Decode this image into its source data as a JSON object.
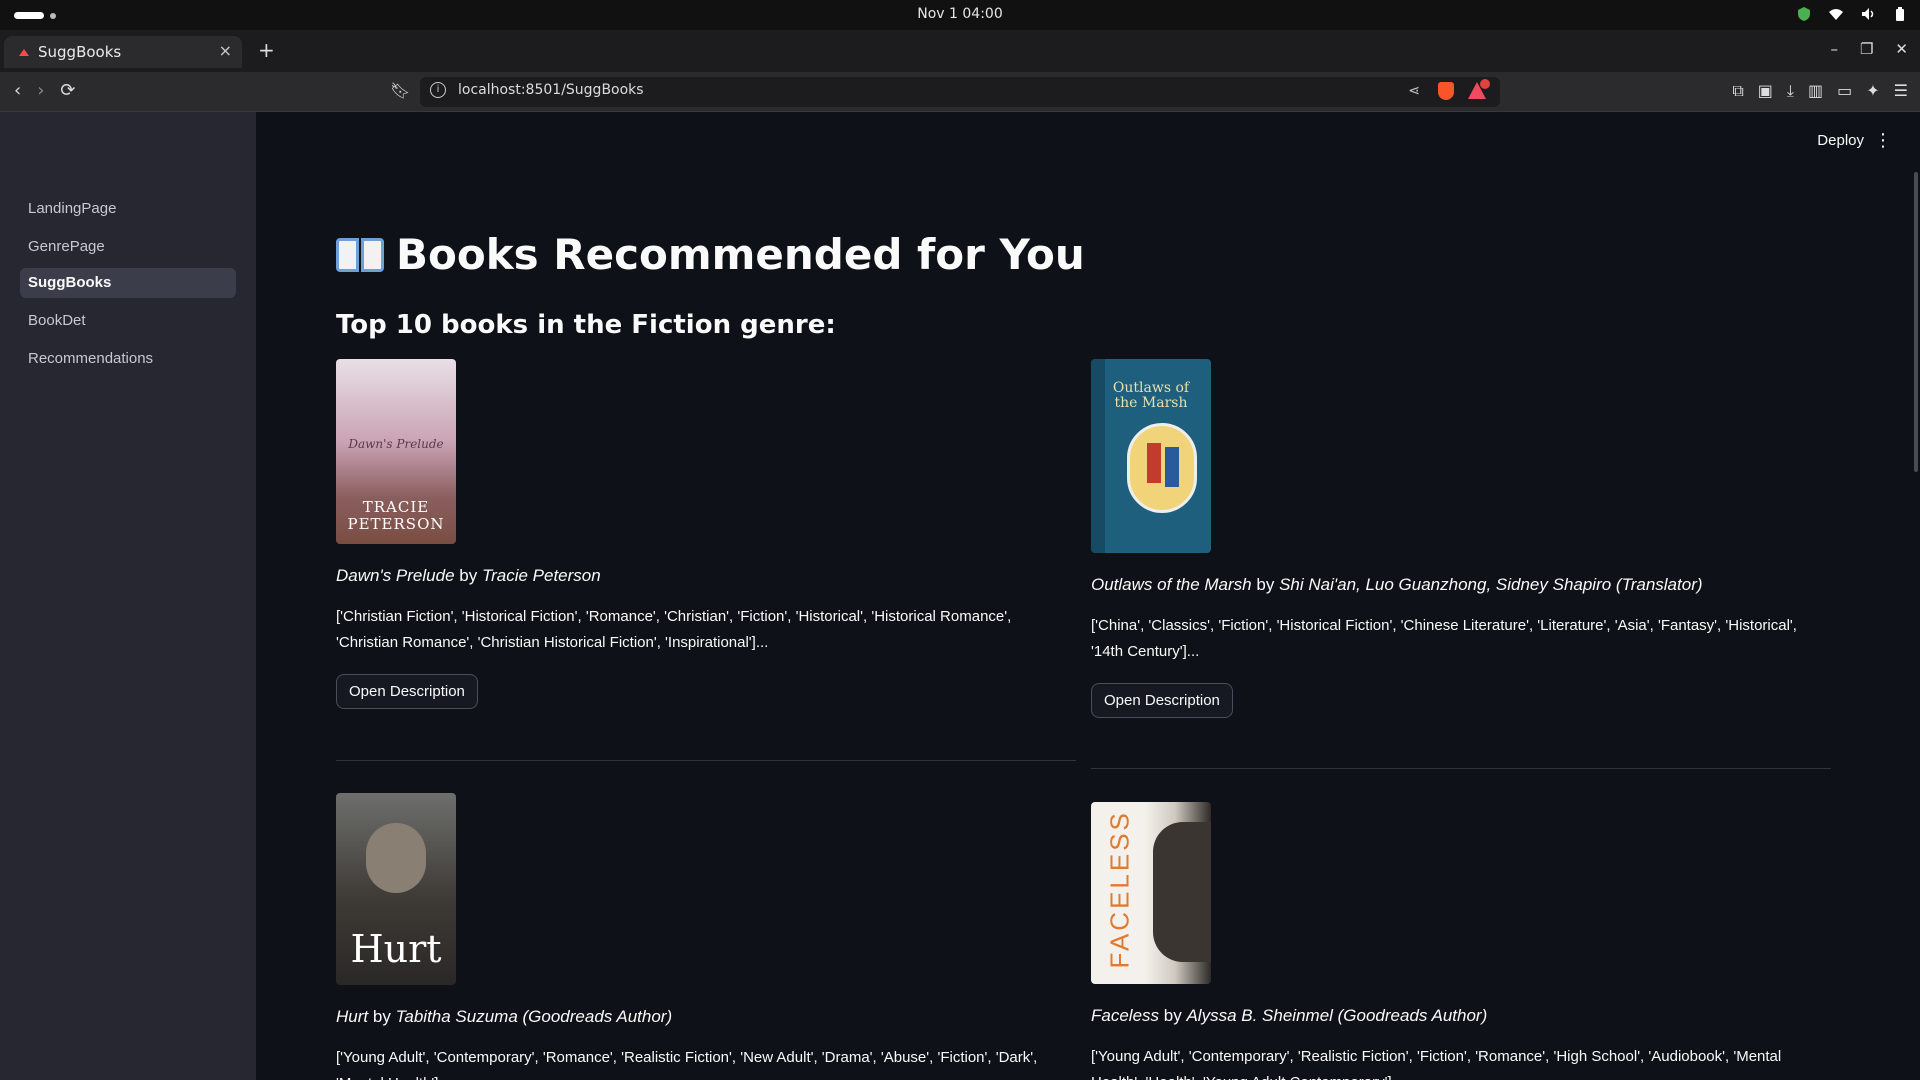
{
  "os": {
    "clock": "Nov 1  04:00"
  },
  "browser": {
    "tab_title": "SuggBooks",
    "new_tab": "+",
    "url": "localhost:8501/SuggBooks"
  },
  "app": {
    "deploy_label": "Deploy",
    "sidebar": {
      "items": [
        {
          "label": "LandingPage"
        },
        {
          "label": "GenrePage"
        },
        {
          "label": "SuggBooks"
        },
        {
          "label": "BookDet"
        },
        {
          "label": "Recommendations"
        }
      ],
      "active": "SuggBooks"
    },
    "title": "Books Recommended for You",
    "subtitle": "Top 10 books in the Fiction genre:",
    "by_word": "by",
    "button_label": "Open Description",
    "books": [
      {
        "title": "Dawn's Prelude",
        "author": "Tracie Peterson",
        "genres": "['Christian Fiction', 'Historical Fiction', 'Romance', 'Christian', 'Fiction', 'Historical', 'Historical Romance', 'Christian Romance', 'Christian Historical Fiction', 'Inspirational']..."
      },
      {
        "title": "Outlaws of the Marsh",
        "author": "Shi Nai'an, Luo Guanzhong, Sidney Shapiro (Translator)",
        "genres": "['China', 'Classics', 'Fiction', 'Historical Fiction', 'Chinese Literature', 'Literature', 'Asia', 'Fantasy', 'Historical', '14th Century']..."
      },
      {
        "title": "Hurt",
        "author": "Tabitha Suzuma (Goodreads Author)",
        "genres": "['Young Adult', 'Contemporary', 'Romance', 'Realistic Fiction', 'New Adult', 'Drama', 'Abuse', 'Fiction', 'Dark', 'Mental Health']..."
      },
      {
        "title": "Faceless",
        "author": "Alyssa B. Sheinmel (Goodreads Author)",
        "genres": "['Young Adult', 'Contemporary', 'Realistic Fiction', 'Fiction', 'Romance', 'High School', 'Audiobook', 'Mental Health', 'Health', 'Young Adult Contemporary']..."
      }
    ],
    "covers": [
      {
        "text_top": "Dawn's Prelude",
        "text_bottom": "TRACIE PETERSON"
      },
      {
        "text_top": "Outlaws of the Marsh",
        "text_bottom": ""
      },
      {
        "text_top": "",
        "text_bottom": "Hurt"
      },
      {
        "text_top": "FACELESS",
        "text_bottom": ""
      }
    ]
  }
}
